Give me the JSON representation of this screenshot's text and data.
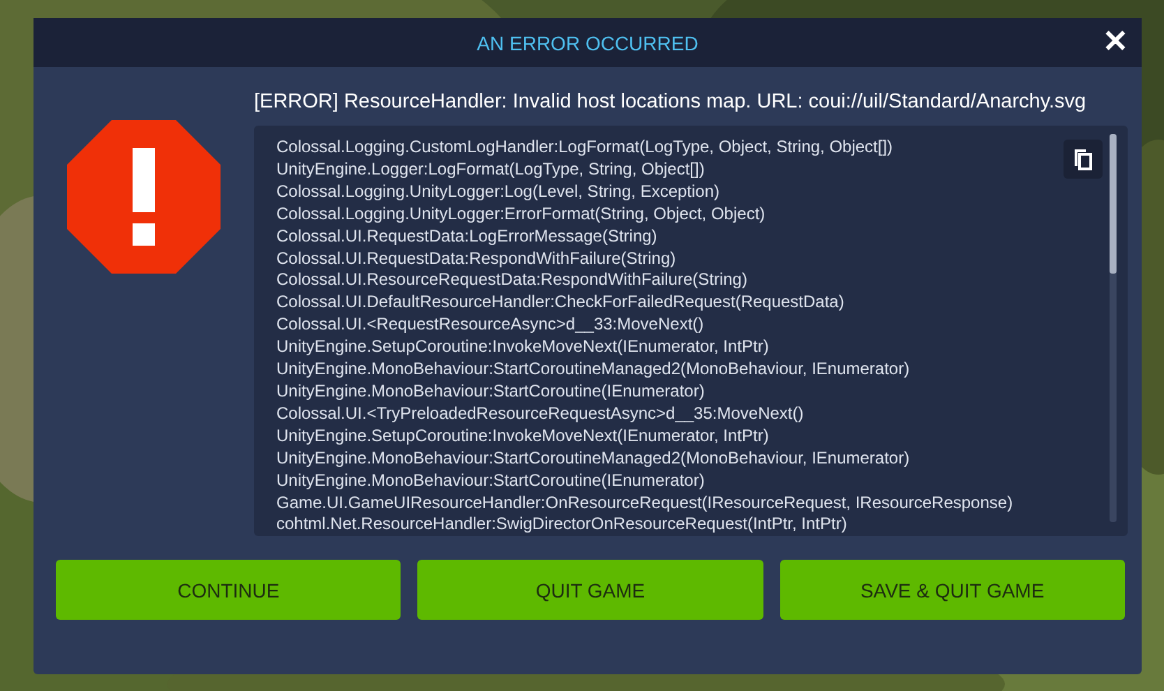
{
  "dialog": {
    "title": "AN ERROR OCCURRED",
    "close": "✕",
    "message": "[ERROR] ResourceHandler: Invalid host locations map. URL: coui://uil/Standard/Anarchy.svg",
    "stack_trace": [
      "Colossal.Logging.CustomLogHandler:LogFormat(LogType, Object, String, Object[])",
      "UnityEngine.Logger:LogFormat(LogType, String, Object[])",
      "Colossal.Logging.UnityLogger:Log(Level, String, Exception)",
      "Colossal.Logging.UnityLogger:ErrorFormat(String, Object, Object)",
      "Colossal.UI.RequestData:LogErrorMessage(String)",
      "Colossal.UI.RequestData:RespondWithFailure(String)",
      "Colossal.UI.ResourceRequestData:RespondWithFailure(String)",
      "Colossal.UI.DefaultResourceHandler:CheckForFailedRequest(RequestData)",
      "Colossal.UI.<RequestResourceAsync>d__33:MoveNext()",
      "UnityEngine.SetupCoroutine:InvokeMoveNext(IEnumerator, IntPtr)",
      "UnityEngine.MonoBehaviour:StartCoroutineManaged2(MonoBehaviour, IEnumerator)",
      "UnityEngine.MonoBehaviour:StartCoroutine(IEnumerator)",
      "Colossal.UI.<TryPreloadedResourceRequestAsync>d__35:MoveNext()",
      "UnityEngine.SetupCoroutine:InvokeMoveNext(IEnumerator, IntPtr)",
      "UnityEngine.MonoBehaviour:StartCoroutineManaged2(MonoBehaviour, IEnumerator)",
      "UnityEngine.MonoBehaviour:StartCoroutine(IEnumerator)",
      "Game.UI.GameUIResourceHandler:OnResourceRequest(IResourceRequest, IResourceResponse)",
      "cohtml.Net.ResourceHandler:SwigDirectorOnResourceRequest(IntPtr, IntPtr)"
    ],
    "buttons": [
      "CONTINUE",
      "QUIT GAME",
      "SAVE & QUIT GAME"
    ]
  }
}
